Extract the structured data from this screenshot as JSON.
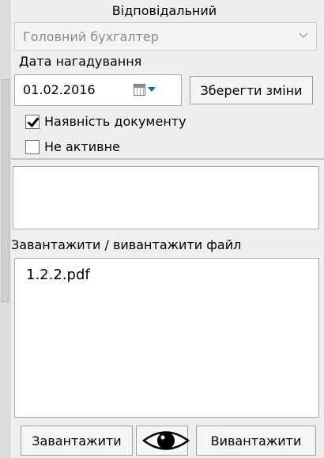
{
  "responsible": {
    "label": "Відповідальний",
    "selected_value": "Головний бухгалтер"
  },
  "reminder": {
    "label": "Дата нагадування",
    "date_value": "01.02.2016",
    "save_button_label": "Зберегти зміни"
  },
  "checkboxes": {
    "has_document": {
      "label": "Наявність документу",
      "checked": true
    },
    "inactive": {
      "label": "Не активне",
      "checked": false
    }
  },
  "files": {
    "label": "Завантажити / вивантажити файл",
    "items": [
      "1.2.2.pdf"
    ],
    "upload_button_label": "Завантажити",
    "download_button_label": "Вивантажити"
  },
  "icons": {
    "combo_arrow": "chevron-down-icon",
    "calendar": "calendar-icon",
    "calendar_dropdown": "caret-down-icon",
    "preview": "eye-icon",
    "checkbox_check": "checkmark-icon"
  }
}
